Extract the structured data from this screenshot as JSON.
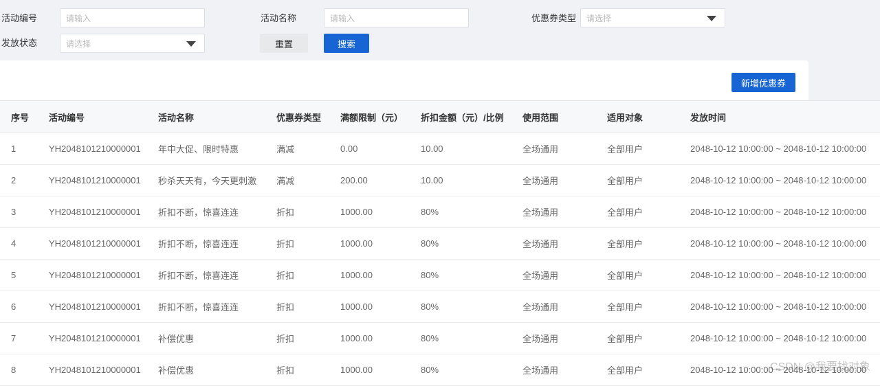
{
  "filters": {
    "activity_code_label": "活动编号",
    "activity_code_placeholder": "请输入",
    "activity_name_label": "活动名称",
    "activity_name_placeholder": "请输入",
    "coupon_type_label": "优惠券类型",
    "coupon_type_placeholder": "请选择",
    "issue_status_label": "发放状态",
    "issue_status_placeholder": "请选择",
    "reset_label": "重置",
    "search_label": "搜索"
  },
  "toolbar": {
    "add_label": "新增优惠券"
  },
  "colors": {
    "primary": "#1765d4",
    "page_bg": "#f0f2f5",
    "header_bg": "#f7f8fa"
  },
  "table": {
    "columns": [
      "序号",
      "活动编号",
      "活动名称",
      "优惠券类型",
      "满额限制（元）",
      "折扣金额（元）/比例",
      "使用范围",
      "适用对象",
      "发放时间"
    ],
    "rows": [
      [
        "1",
        "YH2048101210000001",
        "年中大促、限时特惠",
        "满减",
        "0.00",
        "10.00",
        "全场通用",
        "全部用户",
        "2048-10-12 10:00:00 ~ 2048-10-12 10:00:00"
      ],
      [
        "2",
        "YH2048101210000001",
        "秒杀天天有，今天更刺激",
        "满减",
        "200.00",
        "10.00",
        "全场通用",
        "全部用户",
        "2048-10-12 10:00:00 ~ 2048-10-12 10:00:00"
      ],
      [
        "3",
        "YH2048101210000001",
        "折扣不断，惊喜连连",
        "折扣",
        "1000.00",
        "80%",
        "全场通用",
        "全部用户",
        "2048-10-12 10:00:00 ~ 2048-10-12 10:00:00"
      ],
      [
        "4",
        "YH2048101210000001",
        "折扣不断，惊喜连连",
        "折扣",
        "1000.00",
        "80%",
        "全场通用",
        "全部用户",
        "2048-10-12 10:00:00 ~ 2048-10-12 10:00:00"
      ],
      [
        "5",
        "YH2048101210000001",
        "折扣不断，惊喜连连",
        "折扣",
        "1000.00",
        "80%",
        "全场通用",
        "全部用户",
        "2048-10-12 10:00:00 ~ 2048-10-12 10:00:00"
      ],
      [
        "6",
        "YH2048101210000001",
        "折扣不断，惊喜连连",
        "折扣",
        "1000.00",
        "80%",
        "全场通用",
        "全部用户",
        "2048-10-12 10:00:00 ~ 2048-10-12 10:00:00"
      ],
      [
        "7",
        "YH2048101210000001",
        "补偿优惠",
        "折扣",
        "1000.00",
        "80%",
        "全场通用",
        "全部用户",
        "2048-10-12 10:00:00 ~ 2048-10-12 10:00:00"
      ],
      [
        "8",
        "YH2048101210000001",
        "补偿优惠",
        "折扣",
        "1000.00",
        "80%",
        "全场通用",
        "全部用户",
        "2048-10-12 10:00:00 ~ 2048-10-12 10:00:00"
      ]
    ]
  },
  "watermark": "CSDN @我要找对象"
}
